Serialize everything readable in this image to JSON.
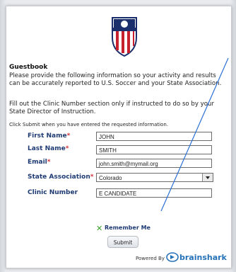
{
  "form": {
    "title": "Guestbook",
    "intro": "Please provide the following information so your activity and results can be accurately reported to U.S. Soccer and your State Association.",
    "clinic_note": "Fill out the Clinic Number section only if instructed to do so by your State Director of Instruction.",
    "submit_note": "Click Submit when you have entered the requested information.",
    "fields": {
      "first_name": {
        "label": "First Name",
        "required_mark": "*",
        "value": "JOHN"
      },
      "last_name": {
        "label": "Last Name",
        "required_mark": "*",
        "value": "SMITH"
      },
      "email": {
        "label": "Email",
        "required_mark": "*",
        "value": "john.smith@mymail.org"
      },
      "state_association": {
        "label": "State Association",
        "required_mark": "*",
        "value": "Colorado"
      },
      "clinic_number": {
        "label": "Clinic Number",
        "value": "E CANDIDATE"
      }
    },
    "remember_me": "Remember Me",
    "submit_label": "Submit"
  },
  "footer": {
    "powered_by": "Powered By",
    "brand": "brainshark"
  },
  "colors": {
    "label": "#1d3a73",
    "required": "#d0323a",
    "brand": "#2572b8",
    "annotation_line": "#2c6fd6"
  },
  "icons": [
    "us-soccer-crest-icon",
    "remember-check-icon",
    "dropdown-arrow-icon",
    "brainshark-logo-icon"
  ]
}
